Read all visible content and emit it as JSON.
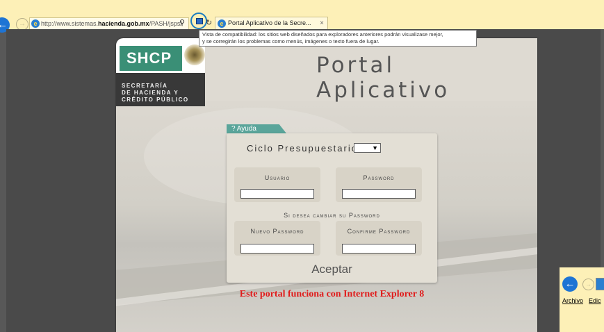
{
  "browser": {
    "address_prefix": "http://www.sistemas.",
    "address_domain": "hacienda.gob.mx",
    "address_suffix": "/PASH/jsps/",
    "tab_title": "Portal Aplicativo de la Secre...",
    "tab_close": "×",
    "tooltip_line1": "Vista de compatibilidad: los sitios web diseñados para exploradores anteriores podrán visualizase mejor,",
    "tooltip_line2": "y se corregirán los problemas como menús, imágenes o texto fuera de lugar."
  },
  "header": {
    "shcp": "SHCP",
    "logo_line1": "SECRETARÍA",
    "logo_line2": "DE HACIENDA Y",
    "logo_line3": "CRÉDITO PÚBLICO",
    "portal_title": "Portal Aplicativo"
  },
  "form": {
    "help_tab": "? Ayuda",
    "ciclo_label": "Ciclo Presupuestario:",
    "usuario_label": "Usuario",
    "password_label": "Password",
    "cambiar_label": "Si desea cambiar su Password",
    "nuevo_label": "Nuevo Password",
    "confirme_label": "Confirme Password",
    "submit_label": "Aceptar"
  },
  "notice": "Este portal funciona con Internet Explorer 8",
  "mini_window": {
    "menu_archivo": "Archivo",
    "menu_edicion": "Edic"
  }
}
